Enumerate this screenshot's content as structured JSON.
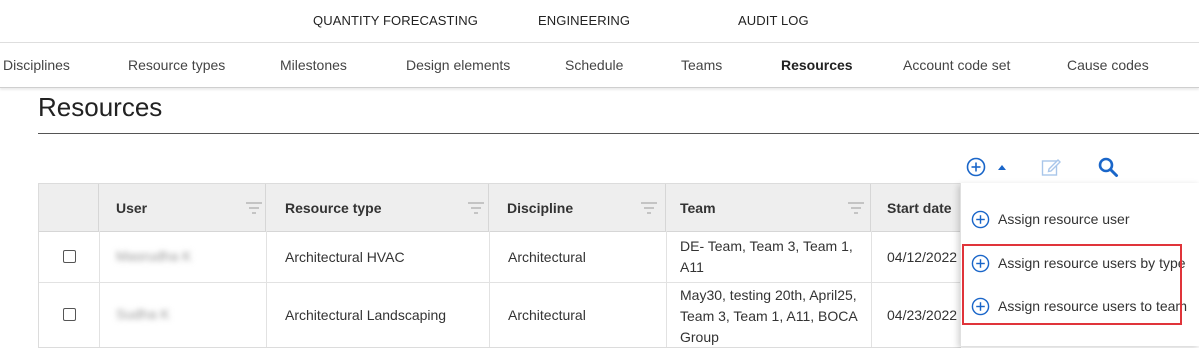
{
  "top_nav": [
    "QUANTITY FORECASTING",
    "ENGINEERING",
    "AUDIT LOG"
  ],
  "sub_nav": [
    "Disciplines",
    "Resource types",
    "Milestones",
    "Design elements",
    "Schedule",
    "Teams",
    "Resources",
    "Account code set",
    "Cause codes"
  ],
  "sub_nav_active": "Resources",
  "page_title": "Resources",
  "toolbar": {
    "icons": [
      "add-circle-icon",
      "caret-up-icon",
      "edit-icon",
      "search-icon"
    ],
    "accent": "#1a66c9"
  },
  "table": {
    "headers": [
      "User",
      "Resource type",
      "Discipline",
      "Team",
      "Start date"
    ],
    "rows": [
      {
        "user": "Masrudha K",
        "resource_type": "Architectural HVAC",
        "discipline": "Architectural",
        "team_lines": [
          "DE- Team, Team 3, Team 1,",
          "A11"
        ],
        "start_date": "04/12/2022"
      },
      {
        "user": "Sudha K",
        "resource_type": "Architectural Landscaping",
        "discipline": "Architectural",
        "team_lines": [
          "May30, testing 20th, April25,",
          "Team 3, Team 1, A11, BOCA",
          "Group"
        ],
        "start_date": "04/23/2022"
      }
    ]
  },
  "menu": {
    "items": [
      "Assign resource user",
      "Assign resource users by type",
      "Assign resource users to team"
    ],
    "highlight_color": "#e0343a"
  }
}
